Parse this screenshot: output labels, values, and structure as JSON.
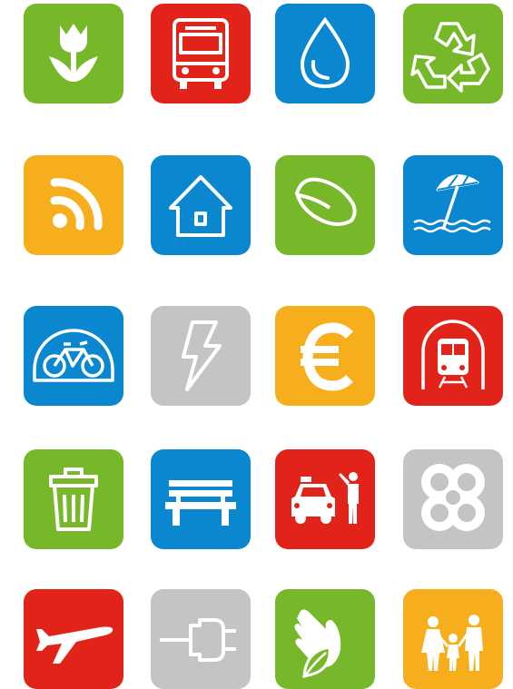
{
  "colors": {
    "green": "#76b82a",
    "red": "#e2231a",
    "blue": "#0a87cf",
    "orange": "#f6ae1d",
    "gray": "#c4c4c4",
    "icon": "#ffffff"
  },
  "icons": [
    {
      "name": "tulip-icon",
      "color": "green"
    },
    {
      "name": "bus-icon",
      "color": "red"
    },
    {
      "name": "water-drop-icon",
      "color": "blue"
    },
    {
      "name": "recycle-icon",
      "color": "green"
    },
    {
      "name": "rss-icon",
      "color": "orange"
    },
    {
      "name": "house-icon",
      "color": "blue"
    },
    {
      "name": "leaf-icon",
      "color": "green"
    },
    {
      "name": "beach-umbrella-icon",
      "color": "blue"
    },
    {
      "name": "bike-parking-icon",
      "color": "blue"
    },
    {
      "name": "lightning-icon",
      "color": "gray"
    },
    {
      "name": "euro-icon",
      "color": "orange"
    },
    {
      "name": "metro-train-icon",
      "color": "red"
    },
    {
      "name": "trash-bin-icon",
      "color": "green"
    },
    {
      "name": "bench-icon",
      "color": "blue"
    },
    {
      "name": "taxi-icon",
      "color": "red"
    },
    {
      "name": "flower-logo-icon",
      "color": "gray"
    },
    {
      "name": "airplane-icon",
      "color": "red"
    },
    {
      "name": "plug-icon",
      "color": "gray"
    },
    {
      "name": "hands-leaf-icon",
      "color": "green"
    },
    {
      "name": "family-icon",
      "color": "orange"
    }
  ]
}
